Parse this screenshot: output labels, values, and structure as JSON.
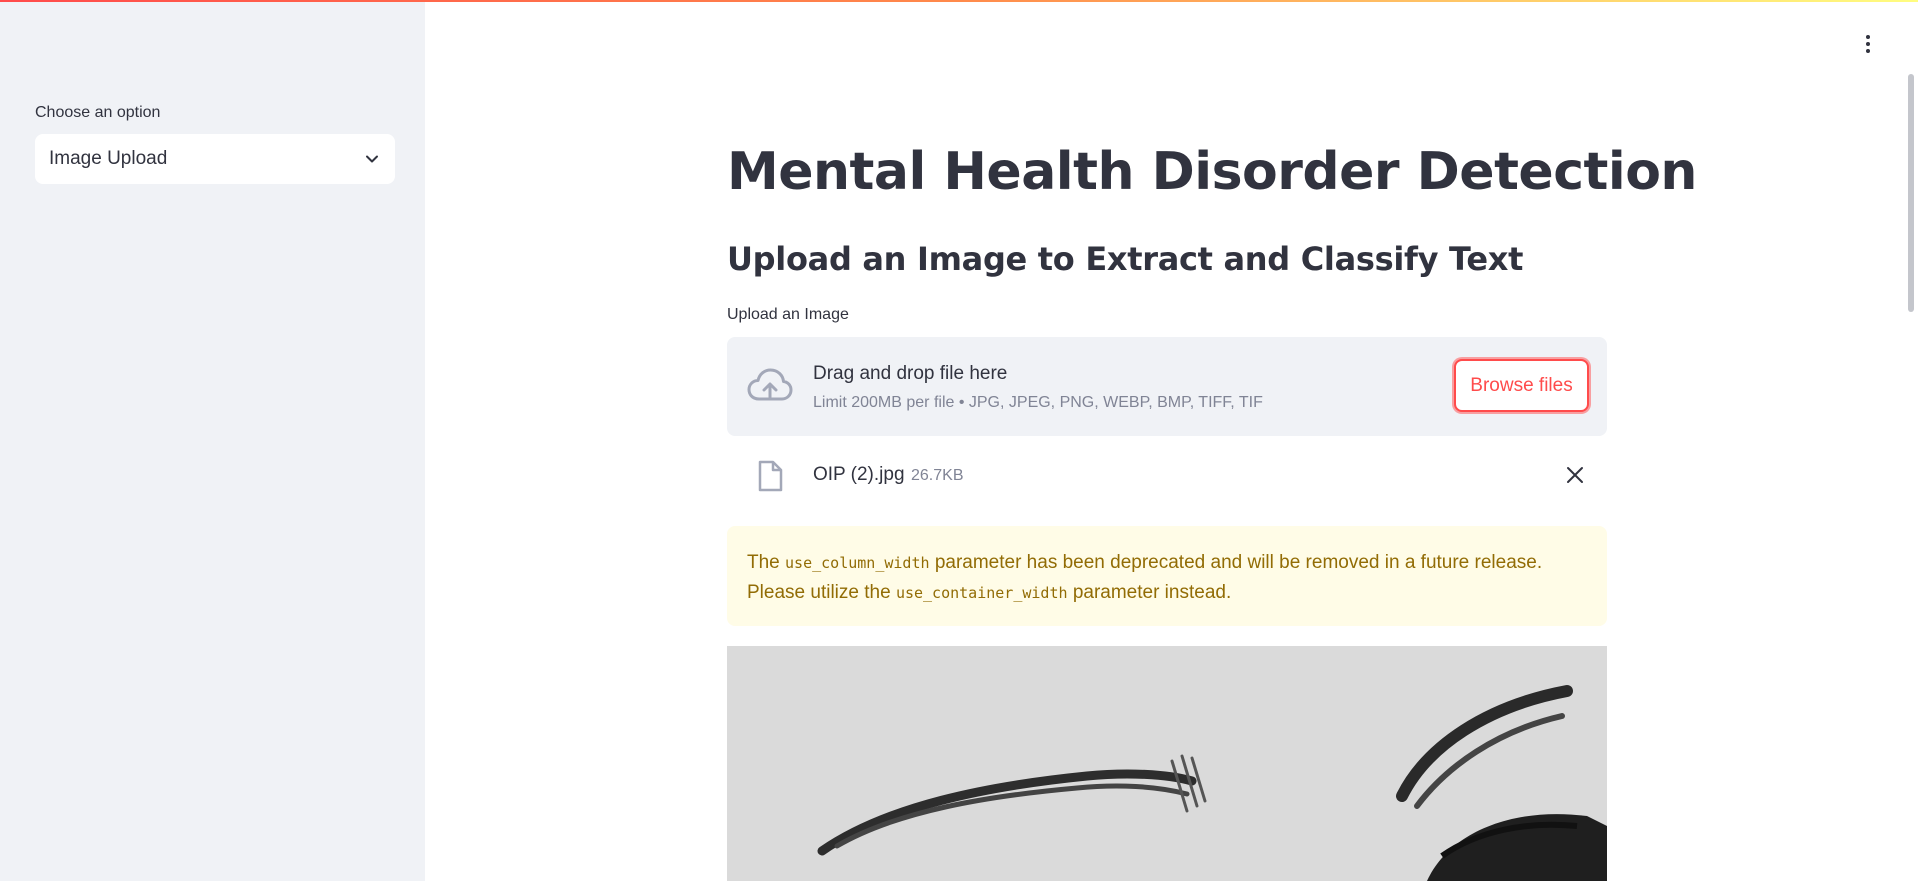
{
  "sidebar": {
    "select_label": "Choose an option",
    "select_value": "Image Upload",
    "chevron_icon": "chevron-down-icon"
  },
  "header": {
    "menu_icon": "kebab-menu-icon"
  },
  "main": {
    "title": "Mental Health Disorder Detection",
    "subtitle": "Upload an Image to Extract and Classify Text",
    "uploader": {
      "label": "Upload an Image",
      "drop_title": "Drag and drop file here",
      "drop_limit": "Limit 200MB per file • JPG, JPEG, PNG, WEBP, BMP, TIFF, TIF",
      "browse_label": "Browse files",
      "icon": "cloud-upload-icon"
    },
    "file": {
      "name": "OIP (2).jpg",
      "size": "26.7KB",
      "icon": "file-icon",
      "remove_icon": "close-icon"
    },
    "warning": {
      "text_1": "The",
      "code_1": "use_column_width",
      "text_2": "parameter has been deprecated and will be removed in a future release. Please utilize the",
      "code_2": "use_container_width",
      "text_3": "parameter instead."
    }
  },
  "colors": {
    "primary": "#ff4b4b",
    "sidebar_bg": "#f0f2f6",
    "text": "#31333f",
    "muted": "#808495",
    "warning_bg": "#fffce7",
    "warning_text": "#926c05"
  }
}
